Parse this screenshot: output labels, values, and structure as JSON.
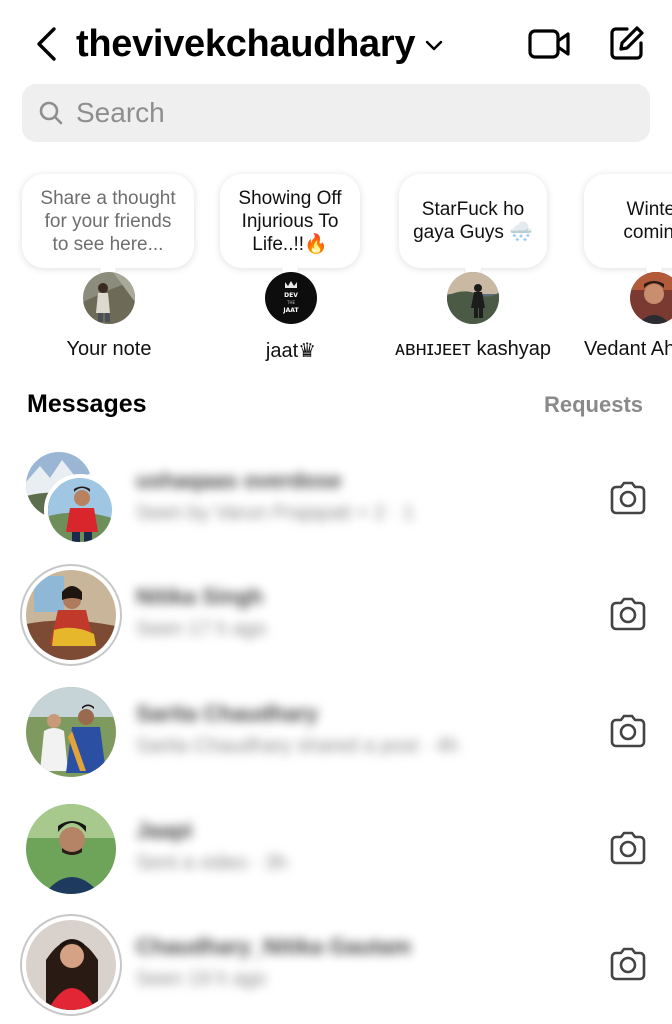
{
  "header": {
    "username": "thevivekchaudhary"
  },
  "search": {
    "placeholder": "Search"
  },
  "notes": [
    {
      "bubble": "Share a thought\nfor your friends\nto see here...",
      "name": "Your note"
    },
    {
      "bubble": "Showing Off\nInjurious To\nLife..!!🔥",
      "name": "jaat♛"
    },
    {
      "bubble": "StarFuck ho\ngaya Guys 🌨️",
      "name": "ᴀʙʜɪᴊᴇᴇᴛ kashyap"
    },
    {
      "bubble": "Winter\ncoming",
      "name": "Vedant Ah"
    }
  ],
  "messages": {
    "title": "Messages",
    "requests": "Requests",
    "conversations": [
      {
        "name": "ushaqaas overdose",
        "preview": "Seen by Varun Prajapati + 2 · 1"
      },
      {
        "name": "Nitika Singh",
        "preview": "Seen 17 h ago"
      },
      {
        "name": "Sarita Chaudhary",
        "preview": "Sarita Chaudhary shared a post · 4h"
      },
      {
        "name": "Jaapi",
        "preview": "Sent a video · 3h"
      },
      {
        "name": "Chaudhary_Nitika Gautam",
        "preview": "Seen 19 h ago"
      }
    ]
  }
}
